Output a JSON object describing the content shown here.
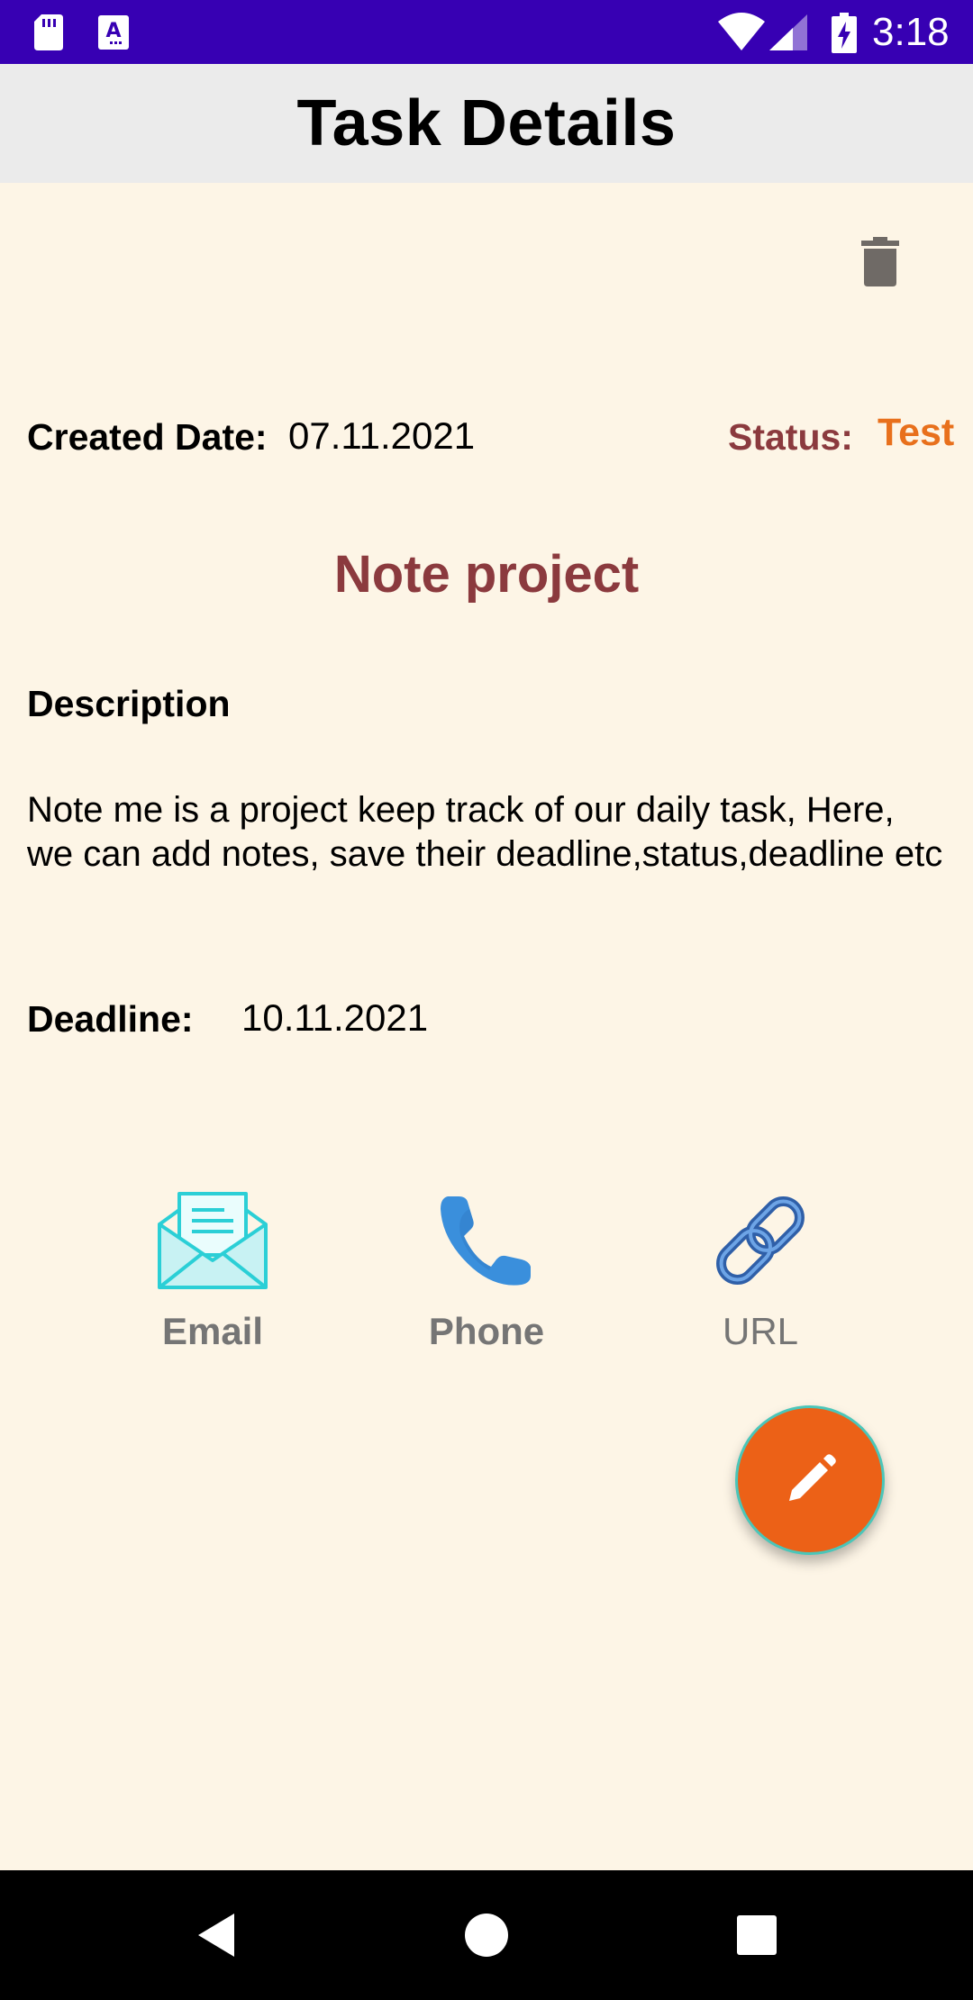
{
  "status_bar": {
    "time": "3:18",
    "icons": [
      "sd-card-icon",
      "a-notification-icon",
      "wifi-icon",
      "signal-icon",
      "battery-charging-icon"
    ]
  },
  "app_bar": {
    "title": "Task Details"
  },
  "toolbar": {
    "delete_icon": "trash-icon"
  },
  "task": {
    "created_label": "Created Date:",
    "created_value": "07.11.2021",
    "status_label": "Status:",
    "status_value": "Test",
    "title": "Note project",
    "description_heading": "Description",
    "description": "Note me is a project keep track of our daily task, Here, we can add notes, save their deadline,status,deadline etc",
    "deadline_label": "Deadline:",
    "deadline_value": "10.11.2021"
  },
  "actions": [
    {
      "label": "Email",
      "icon": "email-icon"
    },
    {
      "label": "Phone",
      "icon": "phone-icon"
    },
    {
      "label": "URL",
      "icon": "link-icon"
    }
  ],
  "fab": {
    "icon": "pencil-icon"
  },
  "nav_bar": {
    "buttons": [
      "back-icon",
      "home-icon",
      "recents-icon"
    ]
  },
  "colors": {
    "status_bar": "#3700b3",
    "app_bar": "#ebebeb",
    "background": "#fdf5e6",
    "accent_title": "#8b3a3e",
    "status_value": "#e8701c",
    "fab": "#ec6117"
  }
}
